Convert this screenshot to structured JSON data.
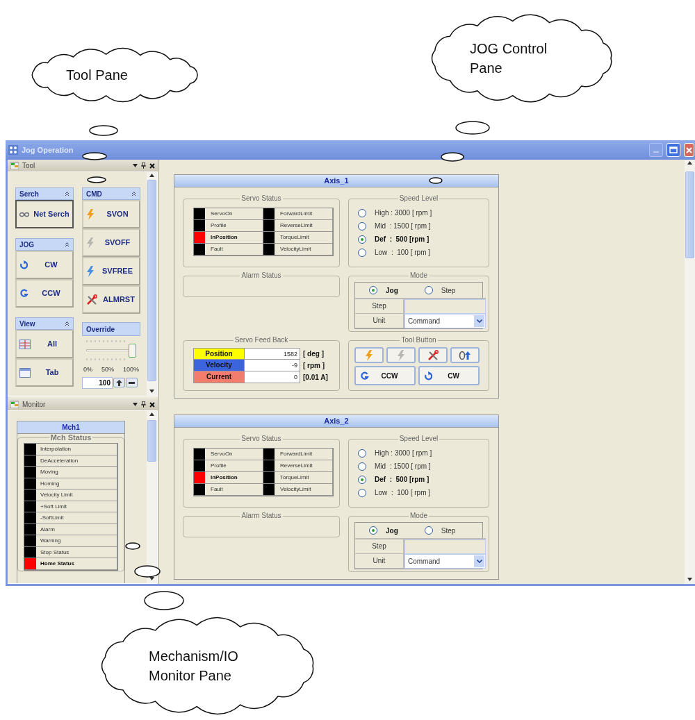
{
  "callouts": [
    {
      "text": "Tool Pane"
    },
    {
      "text": "JOG Control Pane"
    },
    {
      "text": "Mechanism/IO Monitor Pane"
    }
  ],
  "window": {
    "title": "Jog Operation"
  },
  "tool_pane": {
    "title": "Tool",
    "left_groups": [
      {
        "title": "Serch",
        "buttons": [
          {
            "label": "Net Serch",
            "selected": true
          }
        ]
      },
      {
        "title": "JOG",
        "buttons": [
          {
            "label": "CW",
            "selected": false
          },
          {
            "label": "CCW",
            "selected": false
          }
        ]
      },
      {
        "title": "View",
        "buttons": [
          {
            "label": "All",
            "selected": false
          },
          {
            "label": "Tab",
            "selected": false
          }
        ]
      }
    ],
    "right_groups": [
      {
        "title": "CMD",
        "buttons": [
          {
            "label": "SVON",
            "selected": false
          },
          {
            "label": "SVOFF",
            "selected": false
          },
          {
            "label": "SVFREE",
            "selected": false
          },
          {
            "label": "ALMRST",
            "selected": false
          }
        ]
      }
    ],
    "override": {
      "title": "Override",
      "level": 1,
      "scale_labels": [
        "0%",
        "50%",
        "100%"
      ],
      "value": "100"
    }
  },
  "monitor_pane": {
    "title": "Monitor",
    "header": "Mch1",
    "group_title": "Mch Status",
    "items": [
      {
        "label": "Interpolation",
        "on": false
      },
      {
        "label": "DeAcceleration",
        "on": false
      },
      {
        "label": "Moving",
        "on": false
      },
      {
        "label": "Homing",
        "on": false
      },
      {
        "label": "Velocity Limit",
        "on": false
      },
      {
        "label": "+Soft Limit",
        "on": false
      },
      {
        "label": "-SoftLimit",
        "on": false
      },
      {
        "label": "Alarm",
        "on": false
      },
      {
        "label": "Warning",
        "on": false
      },
      {
        "label": "Stop Status",
        "on": false
      },
      {
        "label": "Home Status",
        "on": true
      }
    ]
  },
  "axes": [
    {
      "title": "Axis_1",
      "servo_status": {
        "title": "Servo Status",
        "items": [
          {
            "label": "ServoOn",
            "on": false
          },
          {
            "label": "Profile",
            "on": false
          },
          {
            "label": "InPosition",
            "on": true
          },
          {
            "label": "Fault",
            "on": false
          },
          {
            "label": "ForwardLimit",
            "on": false
          },
          {
            "label": "ReverseLimit",
            "on": false
          },
          {
            "label": "TorqueLimit",
            "on": false
          },
          {
            "label": "VelocityLimit",
            "on": false
          }
        ]
      },
      "speed_level": {
        "title": "Speed Level",
        "options": [
          {
            "label": "High : 3000 [ rpm ]",
            "selected": false
          },
          {
            "label": "Mid  : 1500 [ rpm ]",
            "selected": false
          },
          {
            "label": "Def  :  500 [rpm ]",
            "selected": true
          },
          {
            "label": "Low  :  100 [ rpm ]",
            "selected": false
          }
        ]
      },
      "alarm_status": {
        "title": "Alarm Status"
      },
      "mode": {
        "title": "Mode",
        "options": [
          {
            "label": "Jog",
            "selected": true
          },
          {
            "label": "Step",
            "selected": false
          }
        ],
        "step_label": "Step",
        "unit_label": "Unit",
        "unit_value": "Command"
      },
      "feedback": {
        "title": "Servo Feed Back",
        "rows": [
          {
            "label": "Position",
            "value": "1582",
            "unit": "[ deg ]",
            "color": "#ffff00"
          },
          {
            "label": "Velocity",
            "value": "-9",
            "unit": "[ rpm ]",
            "color": "#3c64dc"
          },
          {
            "label": "Current",
            "value": "0",
            "unit": "[0.01 A]",
            "color": "#f47c6c"
          }
        ]
      },
      "tool_button": {
        "title": "Tool Button",
        "buttons": [
          {
            "label": "CCW"
          },
          {
            "label": "CW"
          }
        ]
      }
    },
    {
      "title": "Axis_2",
      "servo_status": {
        "title": "Servo Status",
        "items": [
          {
            "label": "ServoOn",
            "on": false
          },
          {
            "label": "Profile",
            "on": false
          },
          {
            "label": "InPosition",
            "on": true
          },
          {
            "label": "Fault",
            "on": false
          },
          {
            "label": "ForwardLimit",
            "on": false
          },
          {
            "label": "ReverseLimit",
            "on": false
          },
          {
            "label": "TorqueLimit",
            "on": false
          },
          {
            "label": "VelocityLimit",
            "on": false
          }
        ]
      },
      "speed_level": {
        "title": "Speed Level",
        "options": [
          {
            "label": "High : 3000 [ rpm ]",
            "selected": false
          },
          {
            "label": "Mid  : 1500 [ rpm ]",
            "selected": false
          },
          {
            "label": "Def  :  500 [rpm ]",
            "selected": true
          },
          {
            "label": "Low  :  100 [ rpm ]",
            "selected": false
          }
        ]
      },
      "alarm_status": {
        "title": "Alarm Status"
      },
      "mode": {
        "title": "Mode",
        "options": [
          {
            "label": "Jog",
            "selected": true
          },
          {
            "label": "Step",
            "selected": false
          }
        ],
        "step_label": "Step",
        "unit_label": "Unit",
        "unit_value": "Command"
      }
    }
  ]
}
